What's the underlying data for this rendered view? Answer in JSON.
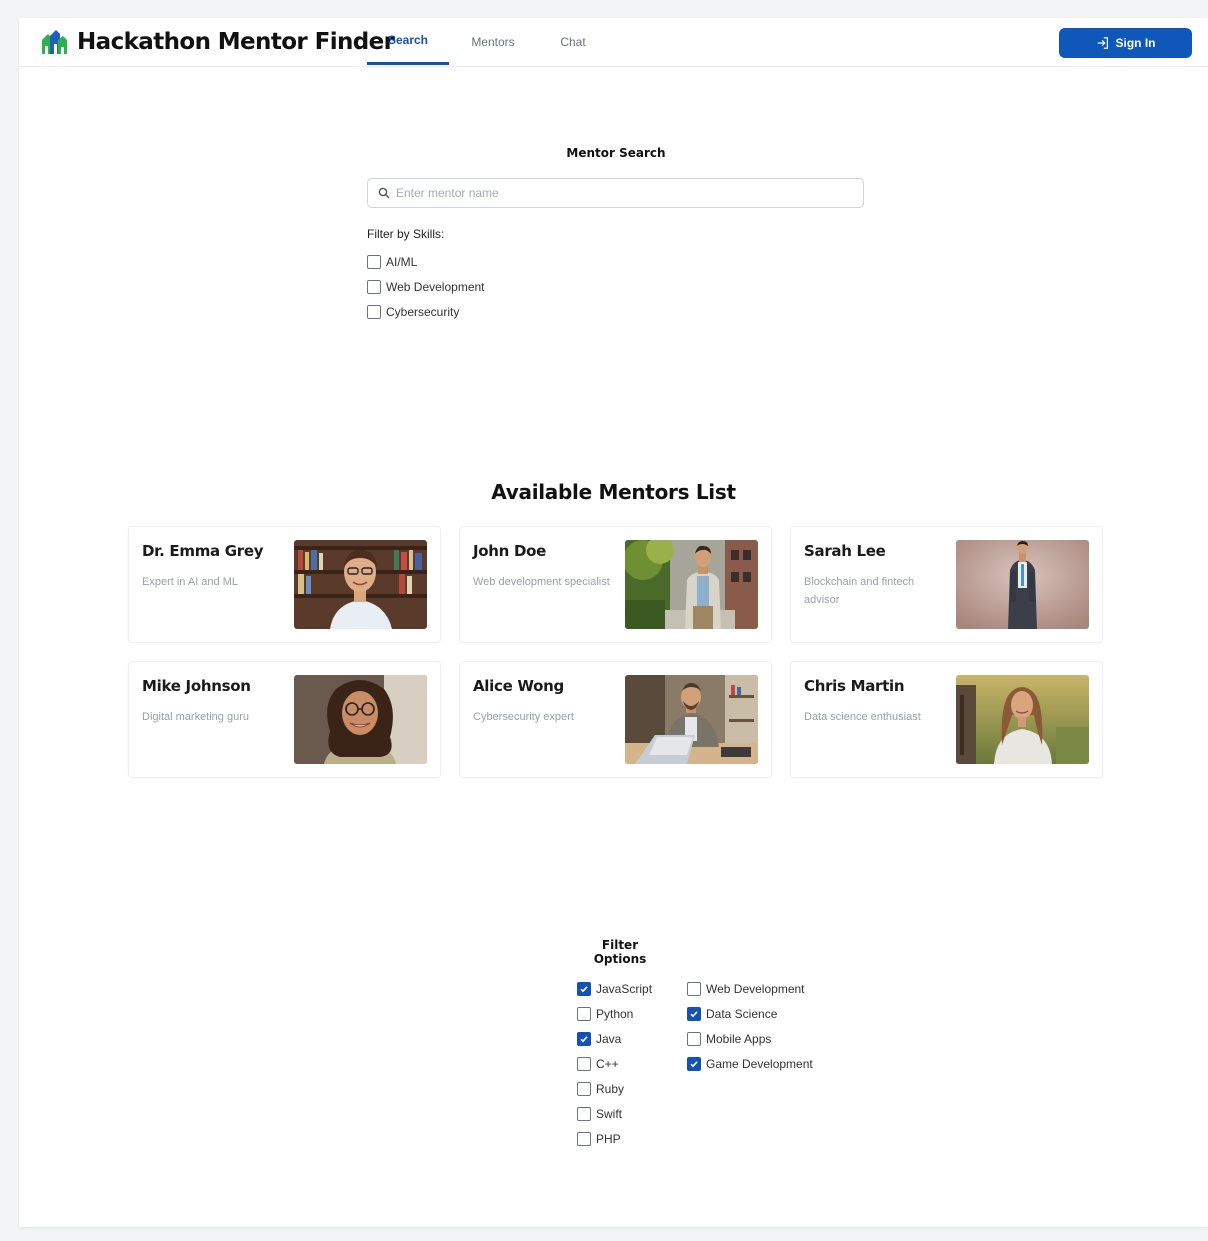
{
  "header": {
    "brand_title": "Hackathon Mentor Finder",
    "tabs": [
      {
        "label": "Search",
        "active": true
      },
      {
        "label": "Mentors",
        "active": false
      },
      {
        "label": "Chat",
        "active": false
      }
    ],
    "signin_label": "Sign In"
  },
  "search": {
    "title": "Mentor Search",
    "placeholder": "Enter mentor name",
    "value": "",
    "filter_label": "Filter by Skills:",
    "skills": [
      {
        "label": "AI/ML",
        "checked": false
      },
      {
        "label": "Web Development",
        "checked": false
      },
      {
        "label": "Cybersecurity",
        "checked": false
      }
    ]
  },
  "mentors": {
    "title": "Available Mentors List",
    "items": [
      {
        "name": "Dr. Emma Grey",
        "description": "Expert in AI and ML",
        "photo": "portrait-library"
      },
      {
        "name": "John Doe",
        "description": "Web development specialist",
        "photo": "portrait-street"
      },
      {
        "name": "Sarah Lee",
        "description": "Blockchain and fintech advisor",
        "photo": "portrait-suit"
      },
      {
        "name": "Mike Johnson",
        "description": "Digital marketing guru",
        "photo": "portrait-curly"
      },
      {
        "name": "Alice Wong",
        "description": "Cybersecurity expert",
        "photo": "portrait-laptop"
      },
      {
        "name": "Chris Martin",
        "description": "Data science enthusiast",
        "photo": "portrait-outdoor"
      }
    ]
  },
  "filter_options": {
    "title": "Filter Options",
    "languages": [
      {
        "label": "JavaScript",
        "checked": true
      },
      {
        "label": "Python",
        "checked": false
      },
      {
        "label": "Java",
        "checked": true
      },
      {
        "label": "C++",
        "checked": false
      },
      {
        "label": "Ruby",
        "checked": false
      },
      {
        "label": "Swift",
        "checked": false
      },
      {
        "label": "PHP",
        "checked": false
      }
    ],
    "areas": [
      {
        "label": "Web Development",
        "checked": false
      },
      {
        "label": "Data Science",
        "checked": true
      },
      {
        "label": "Mobile Apps",
        "checked": false
      },
      {
        "label": "Game Development",
        "checked": true
      }
    ]
  },
  "colors": {
    "accent": "#1351b4",
    "button": "#0f57b8",
    "logo_green": "#2bb24c",
    "logo_blue": "#1e5fbf"
  },
  "icons": {
    "brand": "city-logo-icon",
    "signin": "sign-in-icon",
    "search": "search-icon",
    "check": "checkmark-icon"
  }
}
